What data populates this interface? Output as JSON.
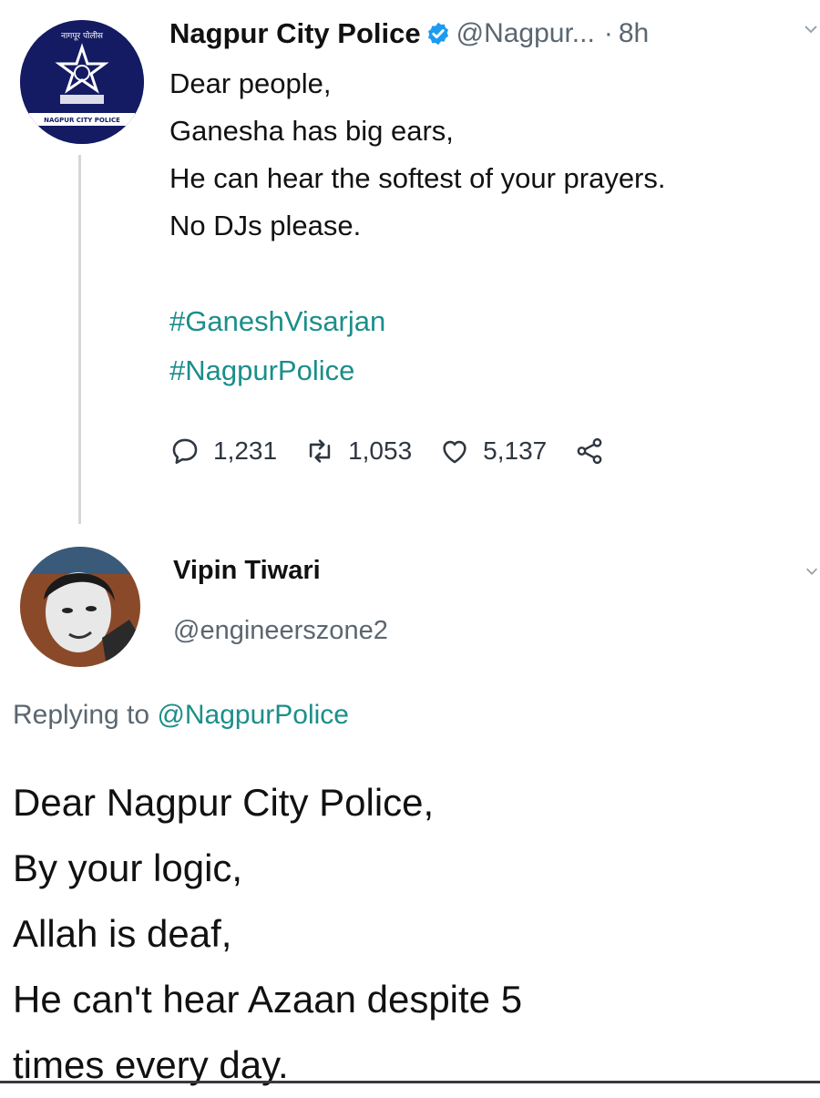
{
  "tweet": {
    "author_name": "Nagpur City Police",
    "handle": "@Nagpur...",
    "separator": "·",
    "time": "8h",
    "lines": [
      "Dear people,",
      "Ganesha has big ears,",
      "He can hear the softest of your prayers.",
      "No DJs please."
    ],
    "hashtags": [
      "#GaneshVisarjan",
      "#NagpurPolice"
    ],
    "replies": "1,231",
    "retweets": "1,053",
    "likes": "5,137",
    "avatar_text_top": "नागपूर पोलीस",
    "avatar_text_band": "NAGPUR CITY POLICE",
    "verified_icon": "verified-badge-icon"
  },
  "reply": {
    "author_name": "Vipin Tiwari",
    "handle": "@engineerszone2",
    "replying_prefix": "Replying to",
    "replying_to": "@NagpurPolice",
    "lines": [
      "Dear Nagpur City Police,",
      "By your logic,",
      "Allah is deaf,",
      "He can't hear Azaan despite 5",
      "times every day."
    ]
  },
  "colors": {
    "hashtag": "#1b8e8a",
    "secondary_text": "#5b6670",
    "verified": "#1d9bf0",
    "police_navy": "#141b63"
  }
}
